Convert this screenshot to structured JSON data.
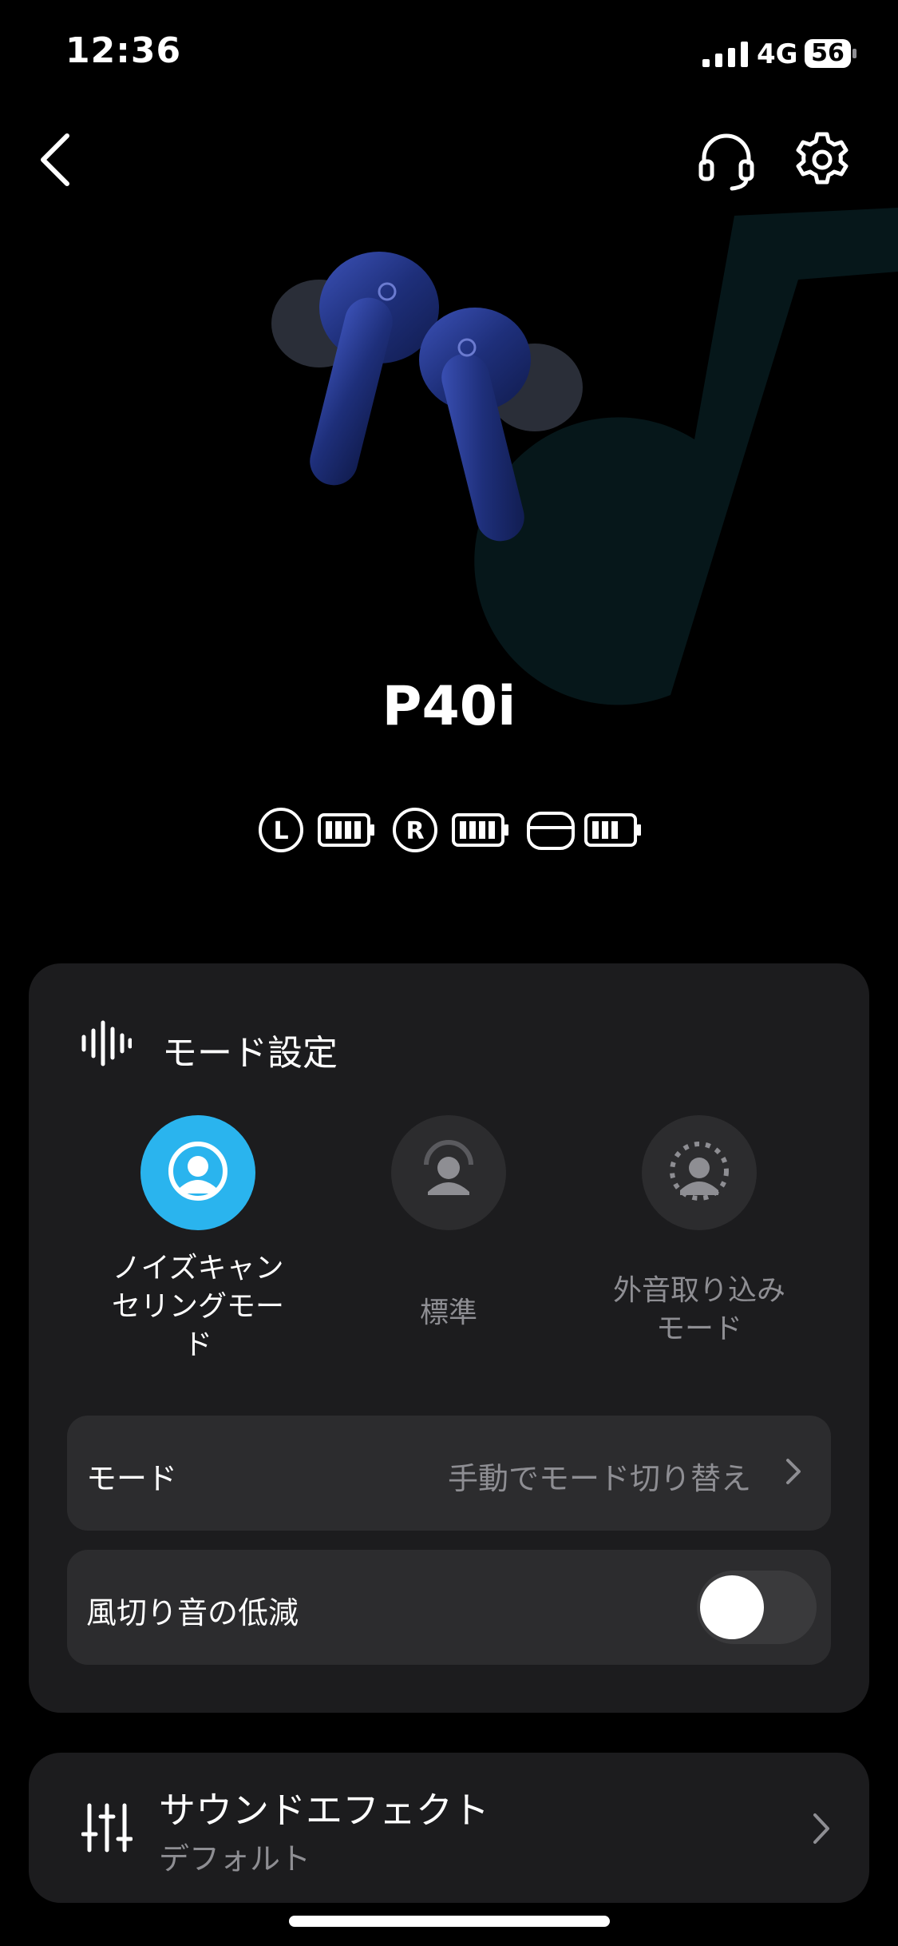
{
  "status_bar": {
    "time": "12:36",
    "network": "4G",
    "battery_level": "56"
  },
  "header": {
    "back_icon": "chevron-left-icon",
    "support_icon": "headset-icon",
    "settings_icon": "gear-icon"
  },
  "device": {
    "name": "P40i",
    "batteries": [
      {
        "side": "L",
        "level": 1.0
      },
      {
        "side": "R",
        "level": 1.0
      },
      {
        "side": "case",
        "level": 0.75
      }
    ]
  },
  "mode_card": {
    "title": "モード設定",
    "options": [
      {
        "label_lines": [
          "ノイズキャン",
          "セリングモー",
          "ド"
        ],
        "active": true
      },
      {
        "label_lines": [
          "標準"
        ],
        "active": false
      },
      {
        "label_lines": [
          "外音取り込み",
          "モード"
        ],
        "active": false
      }
    ],
    "mode_row": {
      "label": "モード",
      "value": "手動でモード切り替え"
    },
    "wind_row": {
      "label": "風切り音の低減",
      "toggle_on": false
    }
  },
  "sound_card": {
    "title": "サウンドエフェクト",
    "subtitle": "デフォルト"
  },
  "colors": {
    "accent": "#2ab4ee",
    "card": "#1c1c1e",
    "row": "#2c2c2e",
    "muted_text": "#8e8e93",
    "logo_bg": "#06171a"
  }
}
